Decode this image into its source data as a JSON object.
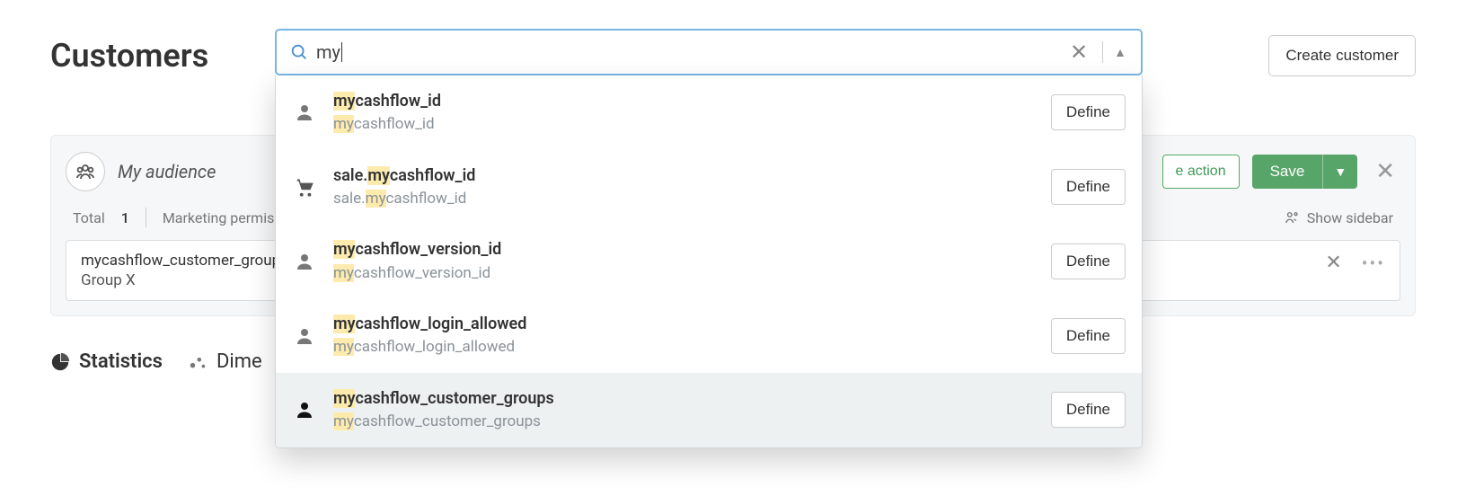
{
  "page": {
    "title": "Customers",
    "create_button": "Create customer"
  },
  "search": {
    "query": "my",
    "clear_title": "Clear",
    "collapse_title": "Collapse"
  },
  "dropdown": {
    "define_label": "Define",
    "items": [
      {
        "icon": "person",
        "title_pre": "my",
        "title_post": "cashflow_id",
        "sub_pre": "my",
        "sub_post": "cashflow_id",
        "highlighted": false
      },
      {
        "icon": "cart",
        "title_plain_pre": "sale.",
        "title_pre": "my",
        "title_post": "cashflow_id",
        "sub_plain_pre": "sale.",
        "sub_pre": "my",
        "sub_post": "cashflow_id",
        "highlighted": false
      },
      {
        "icon": "person",
        "title_pre": "my",
        "title_post": "cashflow_version_id",
        "sub_pre": "my",
        "sub_post": "cashflow_version_id",
        "highlighted": false
      },
      {
        "icon": "person",
        "title_pre": "my",
        "title_post": "cashflow_login_allowed",
        "sub_pre": "my",
        "sub_post": "cashflow_login_allowed",
        "highlighted": false
      },
      {
        "icon": "person-solid",
        "title_pre": "my",
        "title_post": "cashflow_customer_groups",
        "sub_pre": "my",
        "sub_post": "cashflow_customer_groups",
        "highlighted": true
      }
    ]
  },
  "audience": {
    "title": "My audience",
    "create_action": "Create action",
    "create_action_visible_fragment": "e action",
    "save": "Save",
    "meta": {
      "total_label": "Total",
      "total_value": "1",
      "marketing_label": "Marketing permissions",
      "marketing_visible_fragment": "Marketing permis"
    },
    "show_sidebar": "Show sidebar",
    "chip": {
      "title": "mycashflow_customer_groups",
      "subtitle": "Group X"
    }
  },
  "tabs": {
    "statistics": "Statistics",
    "dimensions": "Dimensions",
    "dimensions_visible_fragment": "Dime"
  }
}
